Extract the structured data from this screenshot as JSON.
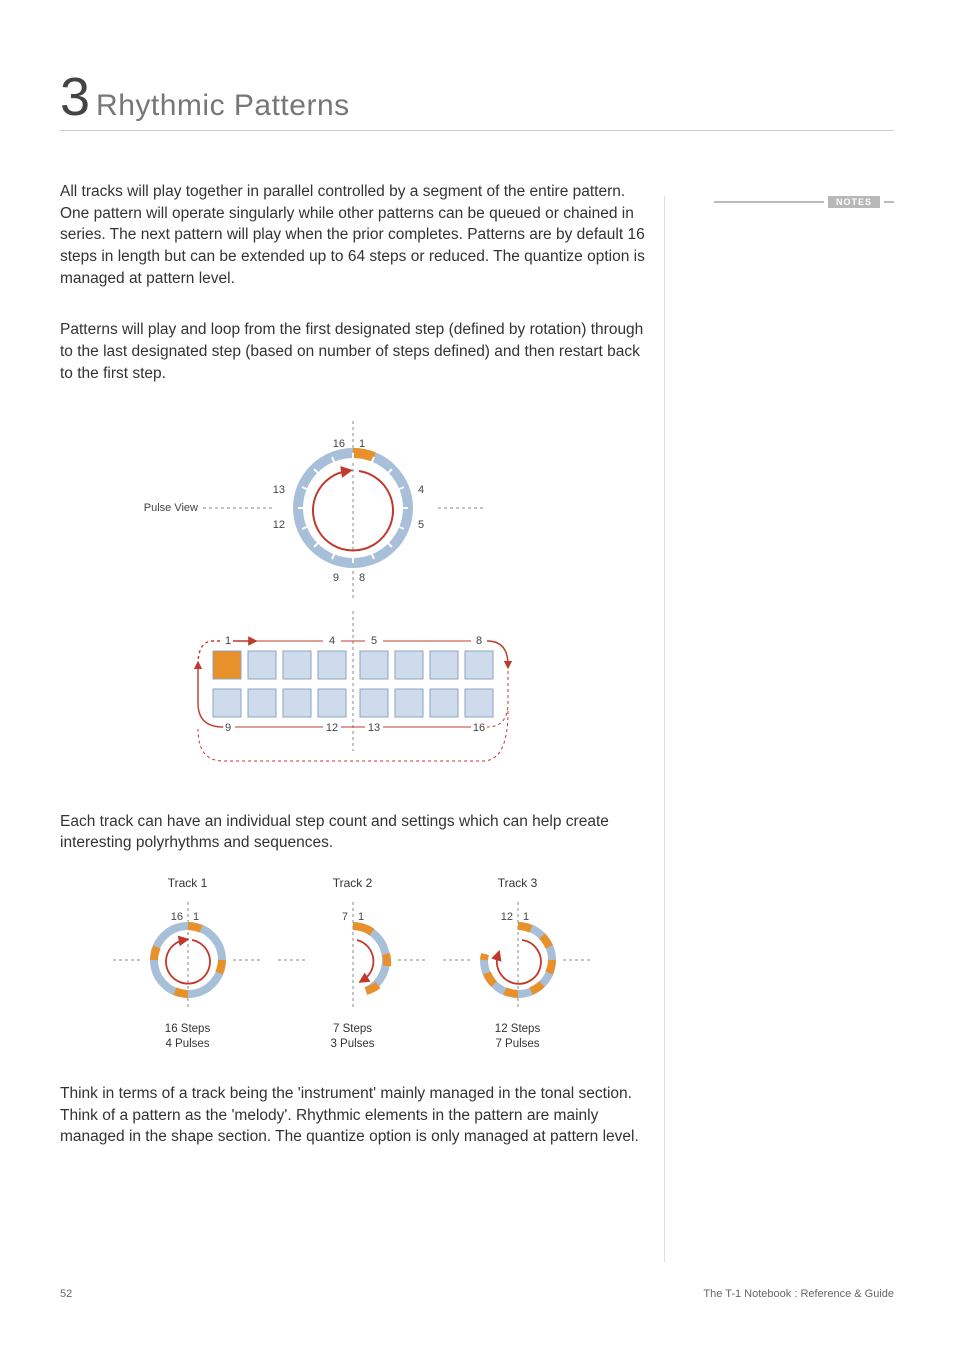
{
  "chapter": {
    "number": "3",
    "title": "Rhythmic Patterns"
  },
  "notes_label": "NOTES",
  "paragraphs": {
    "p1": "All tracks will play together in parallel controlled by a segment of the entire pattern. One pattern will operate singularly while other patterns can be queued or chained in series. The next pattern will play when the prior completes. Patterns are by default 16 steps in length but can be extended up to 64 steps or reduced. The quantize option is managed at pattern level.",
    "p2": "Patterns will play and loop from the first designated step (defined by rotation) through to the last designated step (based on number of steps defined) and then restart back to the first step.",
    "p3": "Each track can have an individual step count and settings which can help create interesting polyrhythms and sequences.",
    "p4": "Think in terms of a track being the 'instrument' mainly managed in the tonal section. Think of a pattern as the 'melody'. Rhythmic elements in the pattern are mainly managed in the shape section.  The quantize option is only managed at pattern level."
  },
  "pulse_view_label": "Pulse View",
  "pulse_ring": {
    "ticks": {
      "n1": "1",
      "n4": "4",
      "n5": "5",
      "n8": "8",
      "n9": "9",
      "n12": "12",
      "n13": "13",
      "n16": "16"
    }
  },
  "step_grid": {
    "top_labels": {
      "l1": "1",
      "l4": "4",
      "l5": "5",
      "l8": "8"
    },
    "bottom_labels": {
      "l9": "9",
      "l12": "12",
      "l13": "13",
      "l16": "16"
    }
  },
  "tracks": [
    {
      "title": "Track 1",
      "start": "16",
      "end": "1",
      "caption1": "16 Steps",
      "caption2": "4 Pulses"
    },
    {
      "title": "Track 2",
      "start": "7",
      "end": "1",
      "caption1": "7 Steps",
      "caption2": "3 Pulses"
    },
    {
      "title": "Track 3",
      "start": "12",
      "end": "1",
      "caption1": "12 Steps",
      "caption2": "7 Pulses"
    }
  ],
  "footer": {
    "page": "52",
    "doc": "The T-1 Notebook : Reference & Guide"
  }
}
